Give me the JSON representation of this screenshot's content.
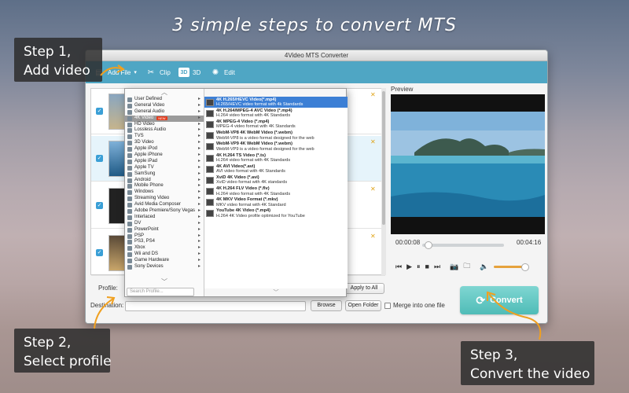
{
  "hero": {
    "title": "3 simple steps to convert MTS"
  },
  "callouts": {
    "step1": [
      "Step 1,",
      "Add video"
    ],
    "step2": [
      "Step 2,",
      "Select profile"
    ],
    "step3": [
      "Step 3,",
      "Convert the video"
    ]
  },
  "window": {
    "title": "4Video MTS Converter",
    "toolbar": {
      "add_file": "Add File",
      "clip": "Clip",
      "three_d_badge": "3D",
      "three_d": "3D",
      "edit": "Edit"
    }
  },
  "categories": [
    "User Defined",
    "General Video",
    "General Audio",
    "4K Video",
    "HD Video",
    "Lossless Audio",
    "TVS",
    "3D Video",
    "Apple iPod",
    "Apple iPhone",
    "Apple iPad",
    "Apple TV",
    "SamSung",
    "Android",
    "Mobile Phone",
    "Windows",
    "Streaming Video",
    "Avid Media Composer",
    "Adobe Premiere/Sony Vegas",
    "Interlaced",
    "DV",
    "PowerPoint",
    "PSP",
    "PS3, PS4",
    "Xbox",
    "Wii and DS",
    "Game Hardware",
    "Sony Devices"
  ],
  "categories_active": "4K Video",
  "new_badge": "NEW",
  "formats": [
    {
      "name": "4K H.265/HEVC Video(*.mp4)",
      "desc": "H.265/HEVC video format with 4k Standards"
    },
    {
      "name": "4K H.264/MPEG-4 AVC Video (*.mp4)",
      "desc": "H.264 video format with 4K Standards"
    },
    {
      "name": "4K MPEG-4 Video (*.mp4)",
      "desc": "MPEG-4 video format with 4K Standards"
    },
    {
      "name": "WebM-VP8 4K WebM Video (*.webm)",
      "desc": "WebM-VP8 is a video format designed for the web"
    },
    {
      "name": "WebM-VP9 4K WebM Video (*.webm)",
      "desc": "WebM-VP9 is a video format designed for the web"
    },
    {
      "name": "4K H.264 TS Video (*.ts)",
      "desc": "H.264 video format with 4K Standards"
    },
    {
      "name": "4K AVI Video(*.avi)",
      "desc": "AVI video format with 4K Standards"
    },
    {
      "name": "XviD 4K Video (*.avi)",
      "desc": "XviD video format with 4K standards"
    },
    {
      "name": "4K H.264 FLV Video (*.flv)",
      "desc": "H.264 video format with 4K Standards"
    },
    {
      "name": "4K MKV Video Format (*.mkv)",
      "desc": "MKV video format with 4K Standard"
    },
    {
      "name": "YouTube 4K Video (*.mp4)",
      "desc": "H.264 4K Video profile optimized for YouTube"
    }
  ],
  "search_profile_placeholder": "Search Profile...",
  "preview": {
    "label": "Preview",
    "time_current": "00:00:08",
    "time_total": "00:04:16",
    "progress": 0.03
  },
  "bottom": {
    "profile_label": "Profile:",
    "destination_label": "Destination:",
    "apply_to_all": "Apply to All",
    "browse": "Browse",
    "open_folder": "Open Folder",
    "merge": "Merge into one file",
    "convert": "Convert"
  }
}
